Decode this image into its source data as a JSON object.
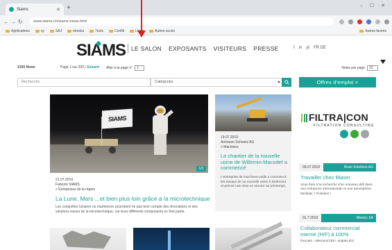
{
  "browser": {
    "tab_title": "Siams",
    "url": "www.siams.ch/siams-news.html",
    "bookmarks": [
      "Applications",
      "sy",
      "SAJ",
      "ebooks",
      "Tools",
      "Conflit",
      "Liens",
      "Autres accès"
    ],
    "other_bookmarks": "Autres favoris"
  },
  "site": {
    "logo": "SIAMS",
    "nav": [
      "LE SALON",
      "EXPOSANTS",
      "VISITEURS",
      "PRESSE"
    ],
    "header_right": [
      "f",
      "in",
      "yt",
      "FR DE"
    ]
  },
  "results": {
    "count": "2155 News",
    "page_prefix": "Page 1 sur 200 |",
    "page_link": "Suivant",
    "goto_label": "Aller à la page n°",
    "goto_value": "1",
    "per_page_label": "News par page",
    "per_page_value": "12"
  },
  "search": {
    "placeholder": "Recherche",
    "category_label": "Catégories",
    "offers_button": "Offres d'emploi  >"
  },
  "feature": {
    "flag_text": "SIAMS",
    "badge": "1/2",
    "date": "21.07.2019",
    "author": "Fabrizio SIAMS",
    "category": "> Entreprises de la région",
    "title": "La Lune, Mars ...et bien plus loin grâce à la microtechnique",
    "excerpt": "Les conquêtes lunaires ou martiennes pourraient ne pas tenir compte des innovations et des solutions issues de la microtechnique, car leurs différents composants en font partie."
  },
  "side_news": {
    "date": "19.07.2019",
    "author": "Ammann Schweiz AG",
    "category": "> Machines",
    "title": "Le chantier de la nouvelle usine de Willemin-Macodel a commencé",
    "excerpt": "L'entreprise de machines-outils a commencé les travaux de sa nouvelle usine à Delémont et prévoit une mise en service au printemps."
  },
  "sponsor": {
    "name": "FILTRA|CON",
    "subtitle": "FILTRATION CONSULTING"
  },
  "jobs": [
    {
      "date": "09.07.2019",
      "company": "Brain Solutions AG",
      "title": "Travailler chez Blaser",
      "text": "Vous êtes à la recherche d'un nouveau défi dans une entreprise internationale et une atmosphère familiale ? Postulez !"
    },
    {
      "date": "01.7.2019",
      "company": "Mirotec SA",
      "title": "Collaborateur commercial interne (H/F) à 100%",
      "text": "français - allemand (B2+ anglais B1)"
    }
  ],
  "colors": {
    "accent": "#1aa097",
    "annotation": "#e0211b"
  }
}
